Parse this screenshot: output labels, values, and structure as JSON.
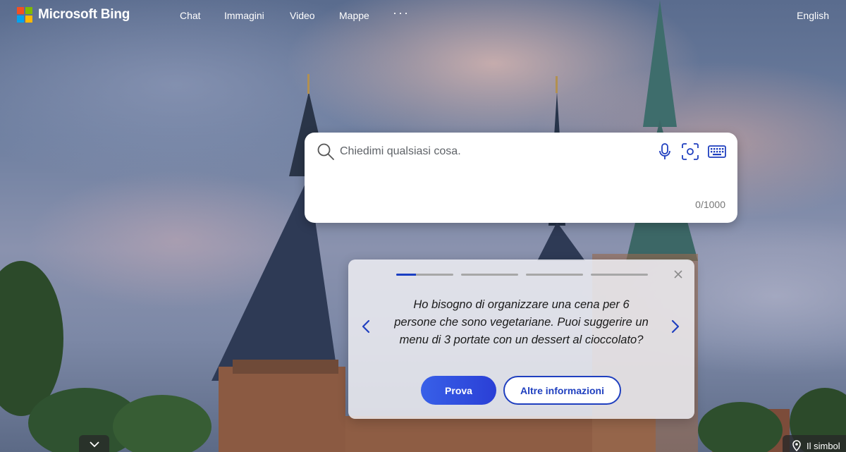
{
  "header": {
    "logo_text": "Microsoft Bing",
    "nav": [
      "Chat",
      "Immagini",
      "Video",
      "Mappe"
    ],
    "more": "···",
    "language": "English"
  },
  "search": {
    "placeholder": "Chiedimi qualsiasi cosa.",
    "counter": "0/1000",
    "icons": [
      "search-icon",
      "microphone-icon",
      "visual-search-icon",
      "keyboard-icon"
    ]
  },
  "suggestion": {
    "progress": [
      0.35,
      0,
      0,
      0
    ],
    "text": "Ho bisogno di organizzare una cena per 6 persone che sono vegetariane. Puoi suggerire un menu di 3 portate con un dessert al cioccolato?",
    "primary_label": "Prova",
    "secondary_label": "Altre informazioni"
  },
  "footer": {
    "location_label": "Il simbol"
  },
  "colors": {
    "accent": "#1f3fbf",
    "primary_button": "#2a3fd6"
  }
}
